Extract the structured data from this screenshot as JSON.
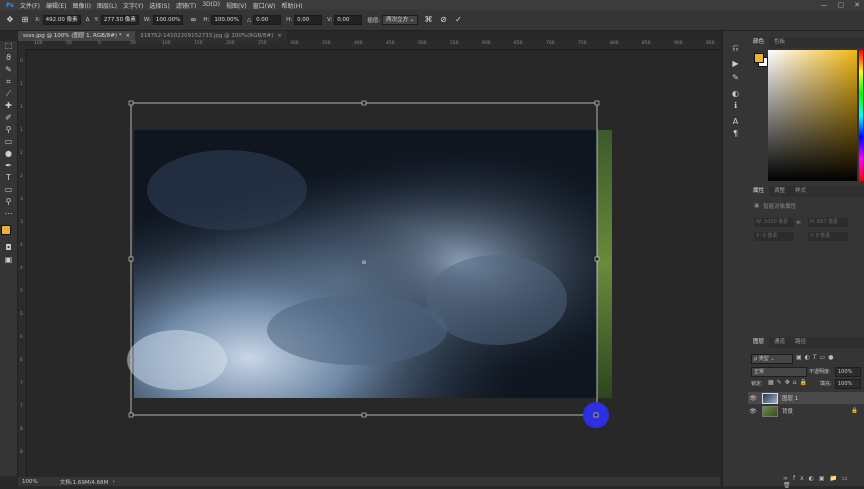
{
  "menu": [
    "文件(F)",
    "编辑(E)",
    "图像(I)",
    "图层(L)",
    "文字(Y)",
    "选择(S)",
    "滤镜(T)",
    "3D(D)",
    "视图(V)",
    "窗口(W)",
    "帮助(H)"
  ],
  "options": {
    "x_label": "X:",
    "x_value": "492.00 像素",
    "y_label": "Y:",
    "y_value": "277.50 像素",
    "w_label": "W:",
    "w_value": "100.00%",
    "h_label": "H:",
    "h_value": "100.00%",
    "angle_value": "0.00",
    "hskew_label": "H:",
    "hskew_value": "0.00",
    "vskew_label": "V:",
    "vskew_value": "0.00",
    "interp_label": "插值:",
    "interp_value": "两次立方"
  },
  "tabs": [
    {
      "label": "ssss.jpg @ 100% (图层 1, RGB/8#) *",
      "active": true
    },
    {
      "label": "318752-14102209152733.jpg @ 100%(RGB/8#)",
      "active": false
    }
  ],
  "ruler_top": [
    "100",
    "50",
    "0",
    "50",
    "100",
    "150",
    "200",
    "250",
    "300",
    "350",
    "400",
    "450",
    "500",
    "550",
    "600",
    "650",
    "700",
    "750",
    "800",
    "850",
    "900",
    "950"
  ],
  "ruler_left": [
    "0",
    "1",
    "1",
    "1",
    "2",
    "2",
    "3",
    "3",
    "4",
    "4",
    "5",
    "5",
    "6",
    "6",
    "7",
    "7",
    "8",
    "8"
  ],
  "status": {
    "zoom": "100%",
    "doc": "文档:1.69M/4.66M"
  },
  "panels": {
    "color_tabs": [
      "颜色",
      "色板"
    ],
    "props_tabs": [
      "属性",
      "调整",
      "样式"
    ],
    "props_title": "智能对象属性",
    "props_w": "W: 1000 像素",
    "props_h": "H: 667 像素",
    "props_x": "X: 0 像素",
    "props_y": "Y: 0 像素",
    "layers_tabs": [
      "图层",
      "通道",
      "路径"
    ],
    "layer_filter": "ρ 类型",
    "blend_mode": "正常",
    "opacity_label": "不透明度:",
    "opacity_value": "100%",
    "lock_label": "锁定:",
    "fill_label": "填充:",
    "fill_value": "100%",
    "layers": [
      {
        "name": "图层 1",
        "selected": true
      },
      {
        "name": "背景",
        "selected": false
      }
    ]
  },
  "colors": {
    "foreground": "#f0b030",
    "background": "#ffffff",
    "accent": "#2b31e0"
  }
}
